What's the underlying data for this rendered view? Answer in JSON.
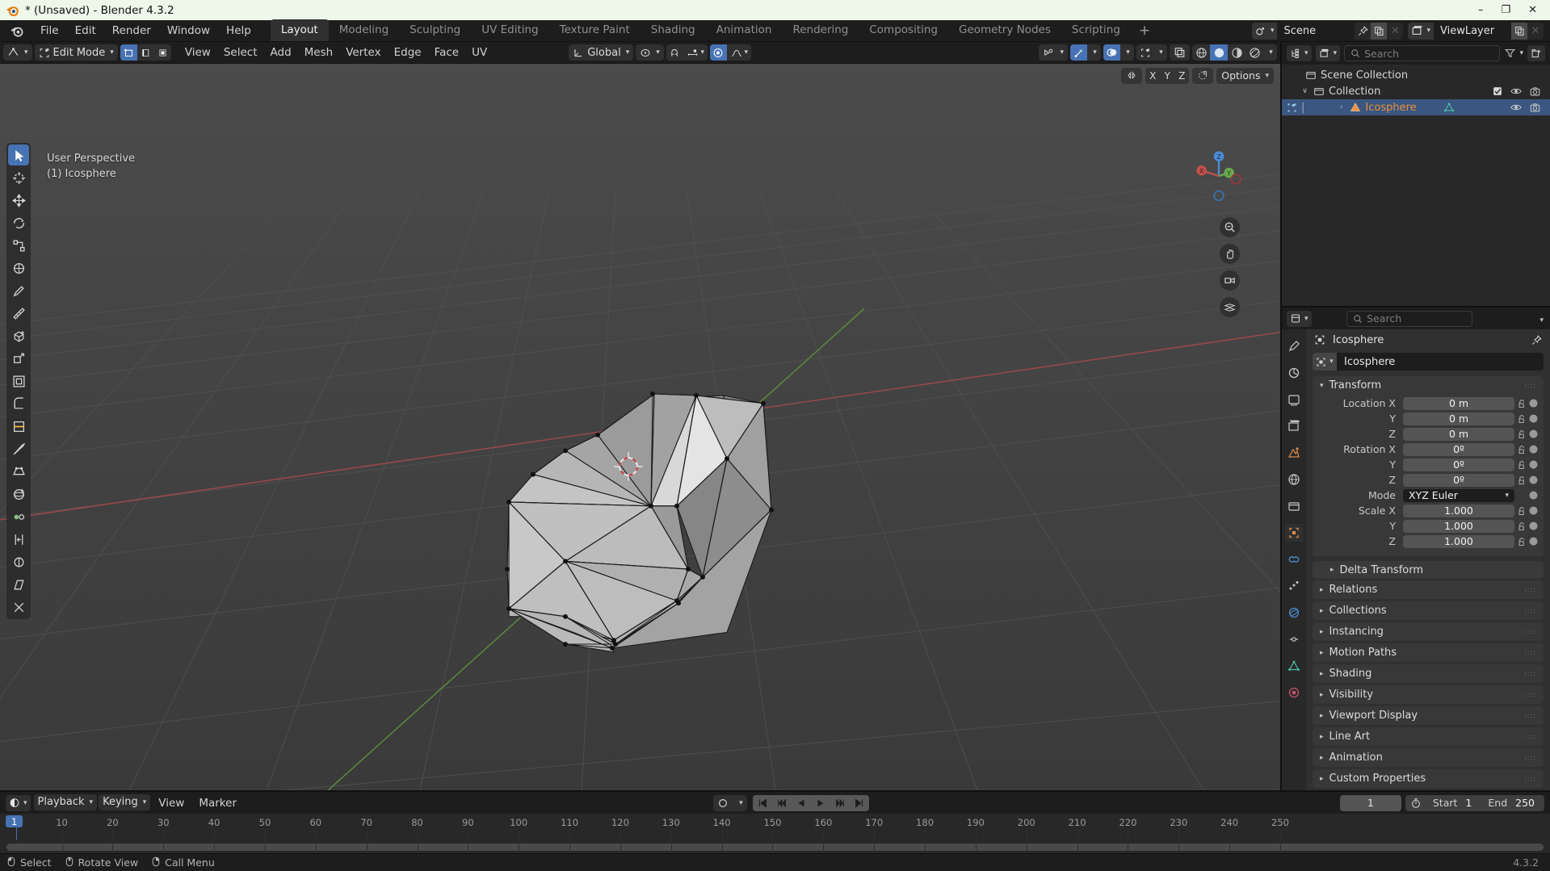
{
  "window": {
    "title": "* (Unsaved) - Blender 4.3.2",
    "minimize": "–",
    "maximize": "❐",
    "close": "✕"
  },
  "topbar": {
    "menus": [
      "File",
      "Edit",
      "Render",
      "Window",
      "Help"
    ],
    "workspaces": [
      {
        "label": "Layout",
        "active": true
      },
      {
        "label": "Modeling",
        "active": false
      },
      {
        "label": "Sculpting",
        "active": false
      },
      {
        "label": "UV Editing",
        "active": false
      },
      {
        "label": "Texture Paint",
        "active": false
      },
      {
        "label": "Shading",
        "active": false
      },
      {
        "label": "Animation",
        "active": false
      },
      {
        "label": "Rendering",
        "active": false
      },
      {
        "label": "Compositing",
        "active": false
      },
      {
        "label": "Geometry Nodes",
        "active": false
      },
      {
        "label": "Scripting",
        "active": false
      }
    ],
    "add_workspace": "+",
    "scene_name": "Scene",
    "viewlayer_name": "ViewLayer"
  },
  "viewport_header": {
    "mode": "Edit Mode",
    "menus": [
      "View",
      "Select",
      "Add",
      "Mesh",
      "Vertex",
      "Edge",
      "Face",
      "UV"
    ],
    "transform_orientation": "Global",
    "select_modes": [
      "vertex-select",
      "edge-select",
      "face-select"
    ],
    "proportional_label": "proportional-editing"
  },
  "viewport": {
    "perspective_label": "User Perspective",
    "collection_label": "(1) Icosphere",
    "options_label": "Options",
    "axis_locks": [
      "X",
      "Y",
      "Z"
    ],
    "gizmo_axes": {
      "x": "X",
      "y": "Y",
      "z": "Z"
    },
    "colors": {
      "background_top": "#4a4a4a",
      "background_bottom": "#383838",
      "grid": "#4f4f4f",
      "axis_x": "#a33b3b",
      "axis_y": "#5a8c3f",
      "mesh_face": "#9b9b9b",
      "select_orange": "#ff8c00"
    },
    "tools": [
      "tweak-select-tool",
      "cursor-tool",
      "move-tool",
      "rotate-tool",
      "scale-tool",
      "transform-tool",
      "annotate-tool",
      "measure-tool",
      "add-cube-tool",
      "extrude-tool",
      "inset-faces-tool",
      "bevel-tool",
      "loop-cut-tool",
      "knife-tool",
      "poly-build-tool",
      "spin-tool",
      "smooth-tool",
      "edge-slide-tool",
      "shrink-fatten-tool",
      "shear-tool",
      "rip-region-tool"
    ],
    "nav_buttons": [
      "zoom-icon",
      "pan-icon",
      "camera-view-icon",
      "toggle-ortho-icon"
    ]
  },
  "outliner": {
    "search_placeholder": "Search",
    "rows": [
      {
        "name": "Scene Collection",
        "indent": 14,
        "icon": "collection-icon",
        "selected": false,
        "expand": "",
        "show_icons": false
      },
      {
        "name": "Collection",
        "indent": 24,
        "icon": "collection-icon",
        "selected": false,
        "expand": "∨",
        "show_icons": true,
        "checkbox": true
      },
      {
        "name": "Icosphere",
        "indent": 44,
        "icon": "mesh-object-icon",
        "selected": true,
        "expand": "›",
        "show_icons": true,
        "data_icon": "mesh-data-icon"
      }
    ]
  },
  "properties": {
    "search_placeholder": "Search",
    "breadcrumb": "Icosphere",
    "object_name": "Icosphere",
    "tabs": [
      "tool-tab",
      "render-tab",
      "output-tab",
      "view-layer-tab",
      "scene-tab",
      "world-tab",
      "collection-tab",
      "object-tab",
      "modifiers-tab",
      "particles-tab",
      "physics-tab",
      "constraints-tab",
      "data-tab",
      "material-tab"
    ],
    "transform_panel": {
      "title": "Transform",
      "rows": [
        {
          "label": "Location X",
          "value": "0 m"
        },
        {
          "label": "Y",
          "value": "0 m"
        },
        {
          "label": "Z",
          "value": "0 m"
        },
        {
          "label": "Rotation X",
          "value": "0º"
        },
        {
          "label": "Y",
          "value": "0º"
        },
        {
          "label": "Z",
          "value": "0º"
        }
      ],
      "mode_label": "Mode",
      "mode_value": "XYZ Euler",
      "scale_rows": [
        {
          "label": "Scale X",
          "value": "1.000"
        },
        {
          "label": "Y",
          "value": "1.000"
        },
        {
          "label": "Z",
          "value": "1.000"
        }
      ],
      "delta_transform": "Delta Transform"
    },
    "panels": [
      "Relations",
      "Collections",
      "Instancing",
      "Motion Paths",
      "Shading",
      "Visibility",
      "Viewport Display",
      "Line Art",
      "Animation",
      "Custom Properties"
    ]
  },
  "timeline": {
    "menus": [
      "Playback",
      "Keying",
      "View",
      "Marker"
    ],
    "current_frame": "1",
    "start_label": "Start",
    "start_value": "1",
    "end_label": "End",
    "end_value": "250",
    "playhead_frame": "1",
    "ticks": [
      10,
      20,
      30,
      40,
      50,
      60,
      70,
      80,
      90,
      100,
      110,
      120,
      130,
      140,
      150,
      160,
      170,
      180,
      190,
      200,
      210,
      220,
      230,
      240,
      250
    ],
    "transport": [
      "jump-to-start",
      "jump-prev-keyframe",
      "play-reverse",
      "play",
      "jump-next-keyframe",
      "jump-to-end"
    ]
  },
  "statusbar": {
    "items": [
      {
        "icon": "mouse-left-icon",
        "label": "Select"
      },
      {
        "icon": "mouse-middle-icon",
        "label": "Rotate View"
      },
      {
        "icon": "mouse-right-icon",
        "label": "Call Menu"
      }
    ],
    "version": "4.3.2"
  }
}
